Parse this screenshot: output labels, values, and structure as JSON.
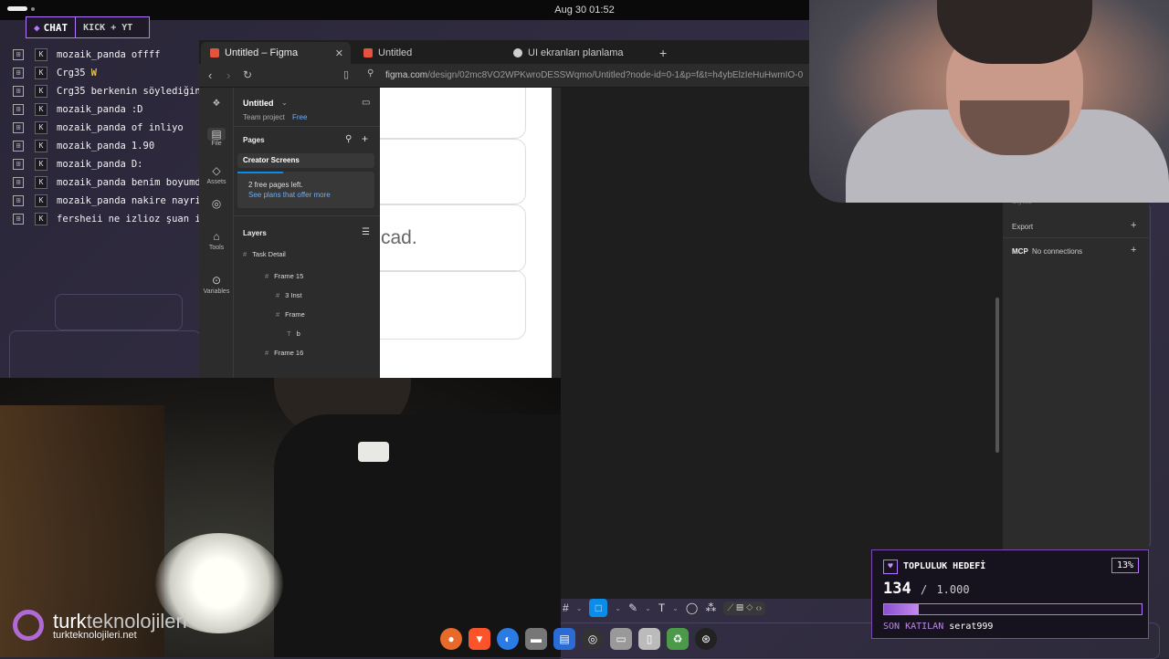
{
  "topbar": {
    "clock": "Aug 30  01:52"
  },
  "chat_overlay": {
    "tab_label": "CHAT",
    "tab_platforms": "KICK + YT",
    "messages": [
      {
        "user": "mozaik_panda",
        "msg": "offff"
      },
      {
        "user": "Crg35",
        "msg": "W",
        "highlight": true
      },
      {
        "user": "Crg35",
        "msg": "berkenin söylediğini mi yapıyorsun"
      },
      {
        "user": "mozaik_panda",
        "msg": ":D"
      },
      {
        "user": "mozaik_panda",
        "msg": "of inliyo"
      },
      {
        "user": "mozaik_panda",
        "msg": "1.90"
      },
      {
        "user": "mozaik_panda",
        "msg": "D:"
      },
      {
        "user": "mozaik_panda",
        "msg": "benim boyumda mı"
      },
      {
        "user": "mozaik_panda",
        "msg": "nakire nayri"
      },
      {
        "user": "fersheii",
        "msg": "ne izlioz şuan ismi ne"
      }
    ]
  },
  "browser": {
    "tabs": [
      {
        "label": "Untitled – Figma",
        "active": true
      },
      {
        "label": "Untitled",
        "active": false
      },
      {
        "label": "UI ekranları planlama",
        "active": false
      }
    ],
    "new_tab": "+",
    "url_host": "figma.com",
    "url_path": "/design/02mc8VO2WPKwroDESSWqmo/Untitled?node-id=0-1&p=f&t=h4ybElzIeHuHwmIO-0"
  },
  "figma": {
    "tools": [
      {
        "name": "File",
        "icon": "file-icon"
      },
      {
        "name": "Assets",
        "icon": "assets-icon"
      },
      {
        "name": "",
        "icon": "circle-icon"
      },
      {
        "name": "Tools",
        "icon": "tools-icon"
      },
      {
        "name": "Variables",
        "icon": "variables-icon"
      }
    ],
    "file_name": "Untitled",
    "team_label": "Team project",
    "plan_badge": "Free",
    "pages_header": "Pages",
    "page_active": "Creator Screens",
    "pages_notice": "2 free pages left.",
    "pages_link": "See plans that offer more",
    "layers_header": "Layers",
    "layers": [
      {
        "label": "Task Detail",
        "indent": 0
      },
      {
        "label": "Frame 15",
        "indent": 2
      },
      {
        "label": "3 Inst",
        "indent": 3
      },
      {
        "label": "Frame",
        "indent": 3
      },
      {
        "label": "b",
        "indent": 4
      },
      {
        "label": "Frame 16",
        "indent": 2
      }
    ],
    "canvas_text": "cad.",
    "props": {
      "export": "Export",
      "mcp": "MCP",
      "mcp_status": "No connections",
      "styles": "Styles"
    }
  },
  "watermark": {
    "brand_a": "turk",
    "brand_b": "teknolojileri",
    "site": "turkteknolojileri.net"
  },
  "goal": {
    "title": "TOPLULUK HEDEFİ",
    "percent_label": "13%",
    "progress": 0.134,
    "current": "134",
    "separator": "/",
    "target": "1.000",
    "last_label": "SON KATILAN",
    "last_user": "serat999"
  },
  "colors": {
    "accent": "#b478ff",
    "figma_blue": "#0c8ce9"
  }
}
